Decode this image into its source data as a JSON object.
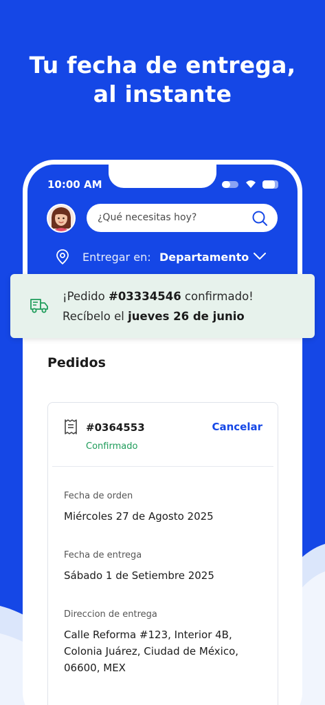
{
  "headline": {
    "line1": "Tu fecha de entrega,",
    "line2": "al instante"
  },
  "status_bar": {
    "time": "10:00 AM"
  },
  "header": {
    "search_placeholder": "¿Qué necesitas hoy?",
    "deliver_label": "Entregar en:",
    "deliver_value": "Departamento"
  },
  "toast": {
    "line1_prefix": "¡Pedido ",
    "order_number": "#03334546",
    "line1_suffix": " confirmado!",
    "line2_prefix": "Recíbelo el ",
    "delivery_day": "jueves 26 de junio"
  },
  "orders": {
    "title": "Pedidos",
    "card": {
      "number": "#0364553",
      "status": "Confirmado",
      "cancel_label": "Cancelar",
      "order_date_label": "Fecha de orden",
      "order_date": "Miércoles 27 de Agosto 2025",
      "delivery_date_label": "Fecha de entrega",
      "delivery_date": "Sábado 1 de Setiembre 2025",
      "address_label": "Direccion de entrega",
      "address_line1": "Calle Reforma #123, Interior 4B,",
      "address_line2": "Colonia Juárez, Ciudad de México,",
      "address_line3": "06600, MEX"
    }
  },
  "colors": {
    "brand_blue": "#1547E6",
    "status_green": "#1e9c5a",
    "toast_bg": "#e7f2ec"
  },
  "icons": [
    "avatar",
    "search-icon",
    "location-pin-icon",
    "chevron-down-icon",
    "delivery-truck-icon",
    "receipt-icon"
  ]
}
